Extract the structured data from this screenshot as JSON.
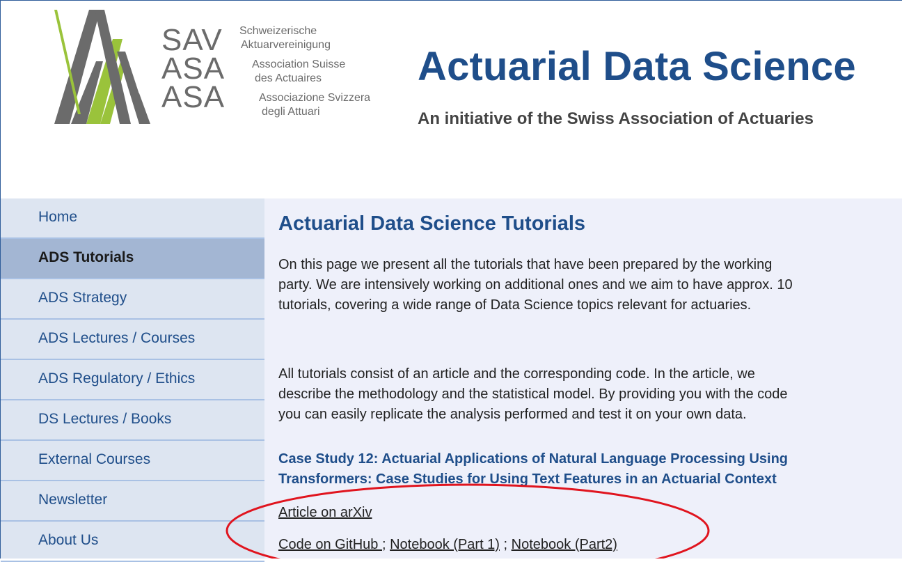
{
  "logo": {
    "abbr": [
      "SAV",
      "ASA",
      "ASA"
    ],
    "names": [
      "Schweizerische",
      "Aktuarvereinigung",
      "Association Suisse",
      "des Actuaires",
      "Associazione Svizzera",
      "degli Attuari"
    ],
    "colors": {
      "gray": "#6b6b6b",
      "green": "#9ac33b"
    }
  },
  "header": {
    "title": "Actuarial Data Science",
    "subtitle": "An initiative of the Swiss Association of Actuaries"
  },
  "sidebar": {
    "items": [
      {
        "label": "Home",
        "active": false
      },
      {
        "label": "ADS Tutorials",
        "active": true
      },
      {
        "label": "ADS Strategy",
        "active": false
      },
      {
        "label": "ADS Lectures / Courses",
        "active": false
      },
      {
        "label": "ADS Regulatory / Ethics",
        "active": false
      },
      {
        "label": "DS Lectures / Books",
        "active": false
      },
      {
        "label": "External Courses",
        "active": false
      },
      {
        "label": "Newsletter",
        "active": false
      },
      {
        "label": "About Us",
        "active": false
      }
    ]
  },
  "main": {
    "title": "Actuarial Data Science Tutorials",
    "intro": [
      "On this page we present all the tutorials that have been prepared by the working",
      "party. We are intensively working on additional ones and we aim to have approx. 10",
      "tutorials, covering a wide range of Data Science topics relevant for actuaries."
    ],
    "body": [
      "All tutorials consist of an article and the corresponding code. In the article, we",
      "describe the methodology and the statistical model. By providing you with the code",
      "you can easily replicate the analysis performed and test it on your own data."
    ],
    "case_study": {
      "title_lines": [
        "Case Study 12: Actuarial Applications of Natural Language Processing Using",
        "Transformers: Case Studies for Using Text Features in an Actuarial Context"
      ],
      "article_link": "Article on arXiv",
      "code_link": "Code on GitHub ",
      "separator": ";",
      "notebook1_link": "Notebook (Part 1)",
      "notebook2_link": "Notebook (Part2)"
    }
  },
  "annotation": {
    "color": "#e0141e"
  }
}
